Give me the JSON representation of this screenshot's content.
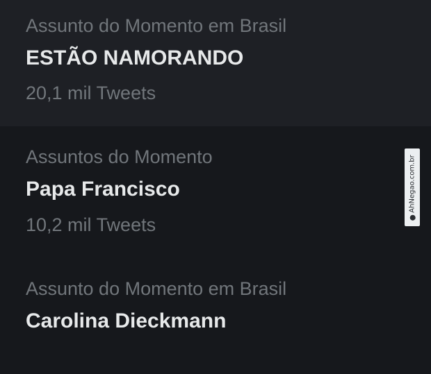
{
  "trends": [
    {
      "context": "Assunto do Momento em Brasil",
      "name": "ESTÃO NAMORANDO",
      "count": "20,1 mil Tweets"
    },
    {
      "context": "Assuntos do Momento",
      "name": "Papa Francisco",
      "count": "10,2 mil Tweets"
    },
    {
      "context": "Assunto do Momento em Brasil",
      "name": "Carolina Dieckmann"
    }
  ],
  "watermark": {
    "text": "AhNegao.com.br",
    "icon": "logo-icon"
  },
  "colors": {
    "background": "#16181c",
    "hover_background": "#1e2025",
    "primary_text": "#e7e9ea",
    "secondary_text": "#71767b"
  }
}
